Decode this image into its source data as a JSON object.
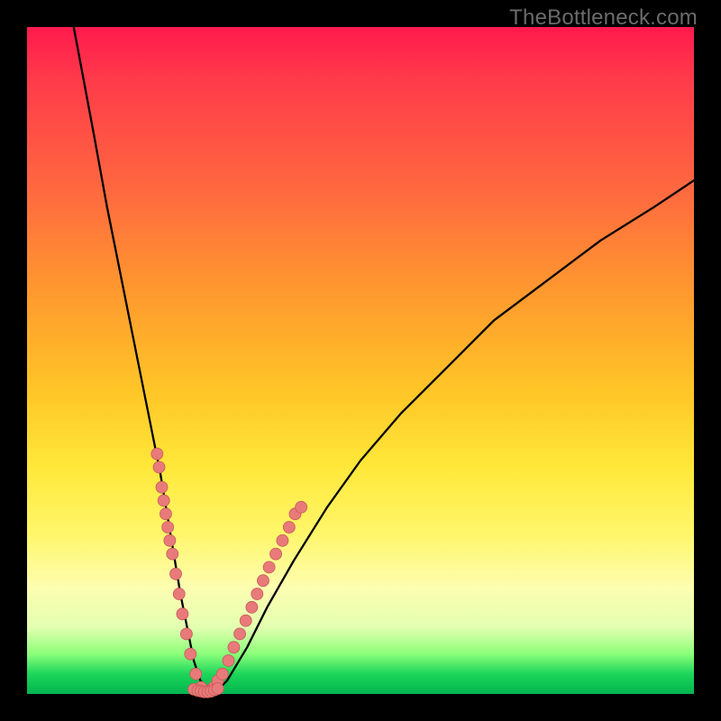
{
  "watermark": "TheBottleneck.com",
  "chart_data": {
    "type": "line",
    "title": "",
    "xlabel": "",
    "ylabel": "",
    "xlim": [
      0,
      100
    ],
    "ylim": [
      0,
      100
    ],
    "grid": false,
    "legend": false,
    "series": [
      {
        "name": "bottleneck-curve",
        "x": [
          7,
          10,
          12,
          14,
          16,
          18,
          20,
          21,
          22,
          23,
          24,
          25,
          26,
          28,
          30,
          33,
          36,
          40,
          45,
          50,
          56,
          63,
          70,
          78,
          86,
          94,
          100
        ],
        "y": [
          100,
          84,
          73,
          63,
          53,
          43,
          33,
          27,
          21,
          15,
          10,
          5,
          2,
          0,
          2,
          7,
          13,
          20,
          28,
          35,
          42,
          49,
          56,
          62,
          68,
          73,
          77
        ]
      }
    ],
    "dot_clusters": [
      {
        "name": "left-branch-dots",
        "points": [
          [
            19.5,
            36
          ],
          [
            19.8,
            34
          ],
          [
            20.2,
            31
          ],
          [
            20.5,
            29
          ],
          [
            20.8,
            27
          ],
          [
            21.1,
            25
          ],
          [
            21.4,
            23
          ],
          [
            21.8,
            21
          ],
          [
            22.3,
            18
          ],
          [
            22.8,
            15
          ],
          [
            23.3,
            12
          ],
          [
            23.9,
            9
          ],
          [
            24.5,
            6
          ],
          [
            25.3,
            3
          ],
          [
            26.1,
            1
          ]
        ]
      },
      {
        "name": "right-branch-dots",
        "points": [
          [
            27.5,
            0.5
          ],
          [
            28.0,
            1
          ],
          [
            28.6,
            2
          ],
          [
            29.3,
            3
          ],
          [
            30.2,
            5
          ],
          [
            31.0,
            7
          ],
          [
            31.9,
            9
          ],
          [
            32.8,
            11
          ],
          [
            33.7,
            13
          ],
          [
            34.5,
            15
          ],
          [
            35.4,
            17
          ],
          [
            36.3,
            19
          ],
          [
            37.3,
            21
          ],
          [
            38.3,
            23
          ],
          [
            39.3,
            25
          ],
          [
            40.2,
            27
          ],
          [
            41.1,
            28
          ]
        ]
      },
      {
        "name": "bottom-cluster-dots",
        "points": [
          [
            25.0,
            0.7
          ],
          [
            25.6,
            0.5
          ],
          [
            26.1,
            0.4
          ],
          [
            26.6,
            0.3
          ],
          [
            27.1,
            0.3
          ],
          [
            27.6,
            0.4
          ],
          [
            28.1,
            0.6
          ],
          [
            28.6,
            0.8
          ]
        ]
      }
    ],
    "colors": {
      "curve": "#000000",
      "dot_fill": "#e97a7a",
      "dot_stroke": "#c65a5a"
    }
  }
}
